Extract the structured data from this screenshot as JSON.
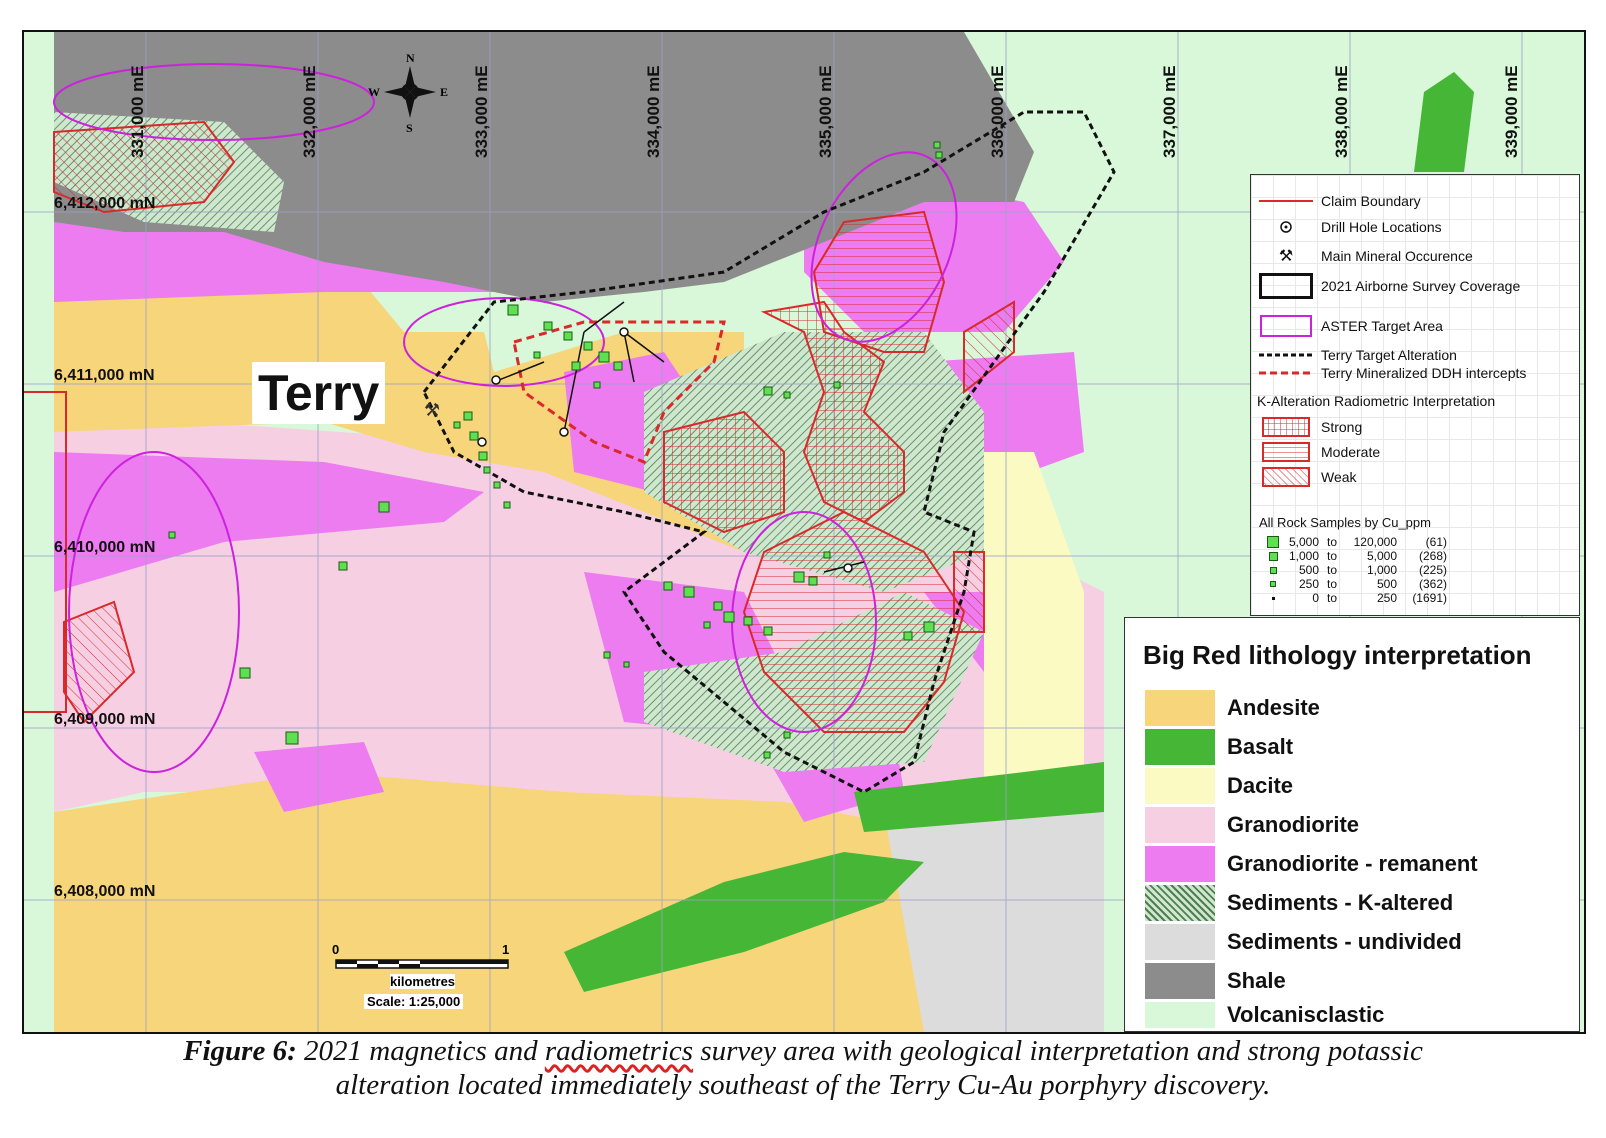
{
  "map": {
    "place_label": "Terry",
    "eastings": [
      "331,000 mE",
      "332,000 mE",
      "333,000 mE",
      "334,000 mE",
      "335,000 mE",
      "336,000 mE",
      "337,000 mE",
      "338,000 mE",
      "339,000 mE"
    ],
    "northings": [
      "6,412,000 mN",
      "6,411,000 mN",
      "6,410,000 mN",
      "6,409,000 mN",
      "6,408,000 mN"
    ],
    "compass": {
      "n": "N",
      "s": "S",
      "e": "E",
      "w": "W"
    },
    "scale": {
      "zero": "0",
      "one": "1",
      "units": "kilometres",
      "ratio": "Scale: 1:25,000"
    }
  },
  "legend_symbols": {
    "items": [
      {
        "label": "Claim Boundary",
        "icon": "red-line"
      },
      {
        "label": "Drill Hole Locations",
        "icon": "drill-hole"
      },
      {
        "label": "Main Mineral Occurence",
        "icon": "crossed-hammers"
      },
      {
        "label": "2021 Airborne Survey Coverage",
        "icon": "black-box"
      },
      {
        "label": "ASTER Target Area",
        "icon": "magenta-box"
      },
      {
        "label": "Terry Target Alteration",
        "icon": "black-dash"
      },
      {
        "label": "Terry Mineralized DDH intercepts",
        "icon": "red-dash"
      }
    ],
    "k_alteration_title": "K-Alteration Radiometric Interpretation",
    "k_alteration": [
      {
        "label": "Strong",
        "pattern": "grid"
      },
      {
        "label": "Moderate",
        "pattern": "horizontal"
      },
      {
        "label": "Weak",
        "pattern": "diagonal"
      }
    ],
    "cu_title": "All Rock Samples by Cu_ppm",
    "cu_classes": [
      {
        "from": "5,000",
        "to_word": "to",
        "to": "120,000",
        "count": "(61)"
      },
      {
        "from": "1,000",
        "to_word": "to",
        "to": "5,000",
        "count": "(268)"
      },
      {
        "from": "500",
        "to_word": "to",
        "to": "1,000",
        "count": "(225)"
      },
      {
        "from": "250",
        "to_word": "to",
        "to": "500",
        "count": "(362)"
      },
      {
        "from": "0",
        "to_word": "to",
        "to": "250",
        "count": "(1691)"
      }
    ]
  },
  "legend_lithology": {
    "title": "Big Red lithology interpretation",
    "units": [
      {
        "label": "Andesite",
        "color": "#f7d57a"
      },
      {
        "label": "Basalt",
        "color": "#45b636"
      },
      {
        "label": "Dacite",
        "color": "#fcfac3"
      },
      {
        "label": "Granodiorite",
        "color": "#f6cfe2"
      },
      {
        "label": "Granodiorite - remanent",
        "color": "#ec7cf0"
      },
      {
        "label": "Sediments - K-altered",
        "color": "#b9d7b9"
      },
      {
        "label": "Sediments - undivided",
        "color": "#dcdcdc"
      },
      {
        "label": "Shale",
        "color": "#8c8c8c"
      },
      {
        "label": "Volcanisclastic",
        "color": "#d9f7d9"
      }
    ]
  },
  "caption": {
    "label": "Figure 6:",
    "text_before": "2021 magnetics and",
    "underlined": "radiometrics",
    "text_after": "survey area with geological interpretation and strong potassic",
    "line2": "alteration located immediately southeast of the Terry Cu-Au porphyry discovery."
  }
}
